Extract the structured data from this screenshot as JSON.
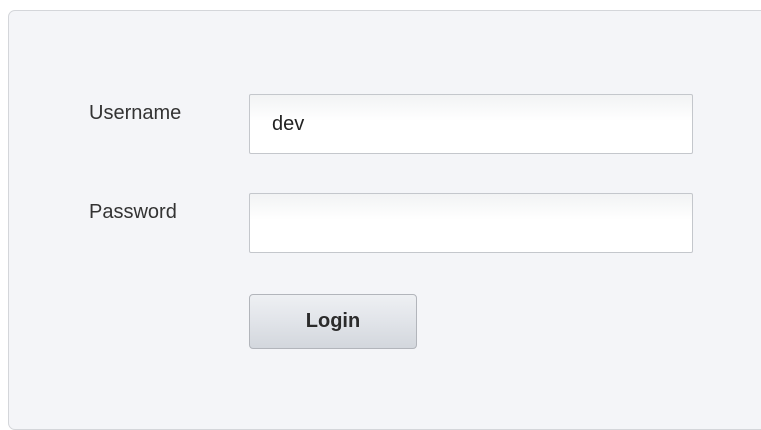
{
  "form": {
    "username_label": "Username",
    "username_value": "dev",
    "password_label": "Password",
    "password_value": "",
    "login_label": "Login"
  }
}
